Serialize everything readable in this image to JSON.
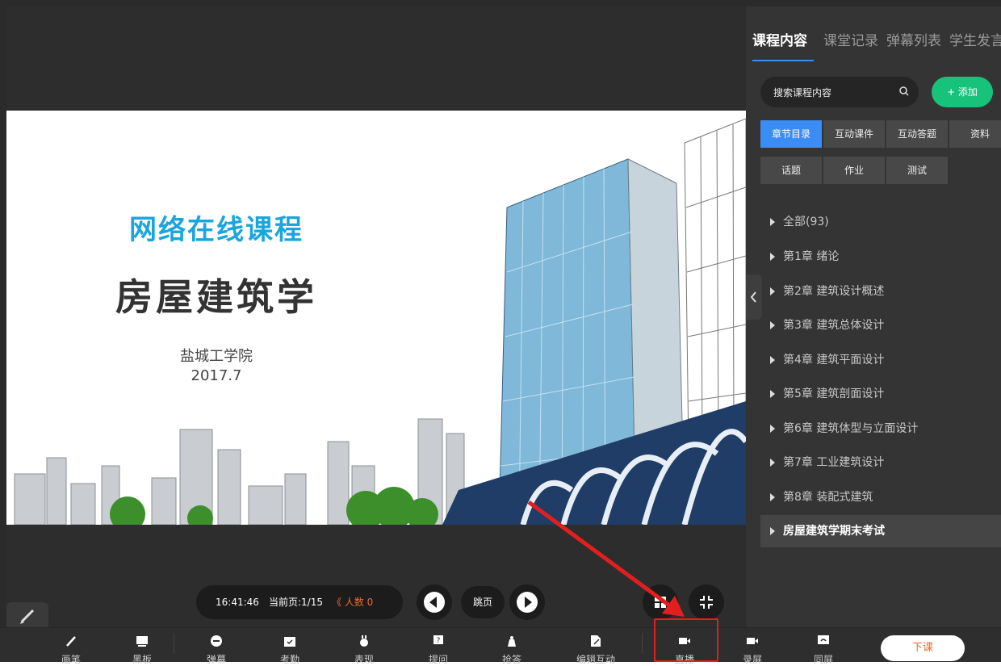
{
  "slide": {
    "title": "网络在线课程",
    "subject": "房屋建筑学",
    "school": "盐城工学院",
    "date": "2017.7"
  },
  "panel": {
    "tabs": [
      "课程内容",
      "课堂记录",
      "弹幕列表",
      "学生发言"
    ],
    "active_tab": "课程内容",
    "search_placeholder": "搜索课程内容",
    "add_label": "+ 添加",
    "categories": [
      "章节目录",
      "互动课件",
      "互动答题",
      "资料",
      "话题",
      "作业",
      "测试"
    ],
    "active_category": "章节目录",
    "chapters": [
      "全部(93)",
      "第1章 绪论",
      "第2章 建筑设计概述",
      "第3章 建筑总体设计",
      "第4章 建筑平面设计",
      "第5章 建筑剖面设计",
      "第6章 建筑体型与立面设计",
      "第7章 工业建筑设计",
      "第8章 装配式建筑",
      "房屋建筑学期末考试"
    ],
    "highlighted_chapter": "房屋建筑学期末考试"
  },
  "controls": {
    "time": "16:41:46",
    "current_page": "当前页:1/15",
    "people_count": "《 人数 0",
    "jump_label": "跳页"
  },
  "toolbar": {
    "items": [
      "画笔",
      "黑板",
      "弹幕",
      "考勤",
      "表现",
      "提问",
      "抢答",
      "编辑互动",
      "直播",
      "录屏",
      "同屏"
    ],
    "highlighted_item": "直播",
    "end_class_label": "下课"
  },
  "colors": {
    "accent_blue": "#3b8cf5",
    "add_green": "#17c27b",
    "highlight_red": "#e21f1f",
    "count_orange": "#f06b2a",
    "title_cyan": "#1aa6dc"
  }
}
